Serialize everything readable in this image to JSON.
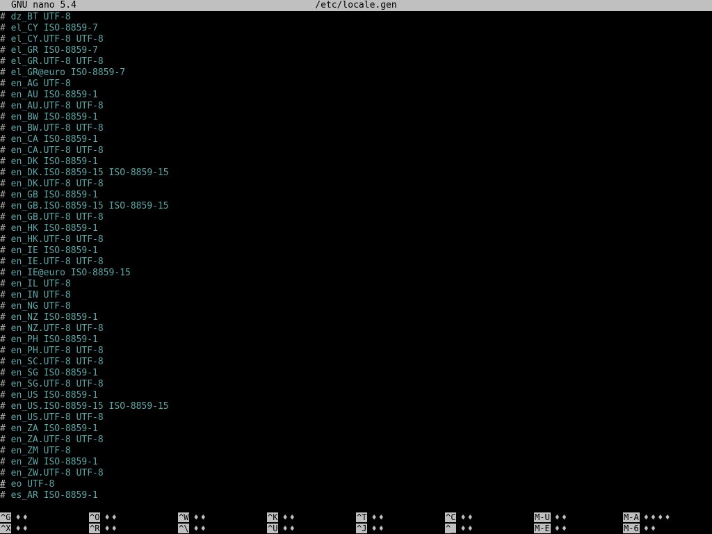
{
  "title_bar": {
    "app": "GNU nano 5.4",
    "file": "/etc/locale.gen"
  },
  "lines": [
    {
      "hash": "#",
      "text": " dz_BT UTF-8"
    },
    {
      "hash": "#",
      "text": " el_CY ISO-8859-7"
    },
    {
      "hash": "#",
      "text": " el_CY.UTF-8 UTF-8"
    },
    {
      "hash": "#",
      "text": " el_GR ISO-8859-7"
    },
    {
      "hash": "#",
      "text": " el_GR.UTF-8 UTF-8"
    },
    {
      "hash": "#",
      "text": " el_GR@euro ISO-8859-7"
    },
    {
      "hash": "#",
      "text": " en_AG UTF-8"
    },
    {
      "hash": "#",
      "text": " en_AU ISO-8859-1"
    },
    {
      "hash": "#",
      "text": " en_AU.UTF-8 UTF-8"
    },
    {
      "hash": "#",
      "text": " en_BW ISO-8859-1"
    },
    {
      "hash": "#",
      "text": " en_BW.UTF-8 UTF-8"
    },
    {
      "hash": "#",
      "text": " en_CA ISO-8859-1"
    },
    {
      "hash": "#",
      "text": " en_CA.UTF-8 UTF-8"
    },
    {
      "hash": "#",
      "text": " en_DK ISO-8859-1"
    },
    {
      "hash": "#",
      "text": " en_DK.ISO-8859-15 ISO-8859-15"
    },
    {
      "hash": "#",
      "text": " en_DK.UTF-8 UTF-8"
    },
    {
      "hash": "#",
      "text": " en_GB ISO-8859-1"
    },
    {
      "hash": "#",
      "text": " en_GB.ISO-8859-15 ISO-8859-15"
    },
    {
      "hash": "#",
      "text": " en_GB.UTF-8 UTF-8"
    },
    {
      "hash": "#",
      "text": " en_HK ISO-8859-1"
    },
    {
      "hash": "#",
      "text": " en_HK.UTF-8 UTF-8"
    },
    {
      "hash": "#",
      "text": " en_IE ISO-8859-1"
    },
    {
      "hash": "#",
      "text": " en_IE.UTF-8 UTF-8"
    },
    {
      "hash": "#",
      "text": " en_IE@euro ISO-8859-15"
    },
    {
      "hash": "#",
      "text": " en_IL UTF-8"
    },
    {
      "hash": "#",
      "text": " en_IN UTF-8"
    },
    {
      "hash": "#",
      "text": " en_NG UTF-8"
    },
    {
      "hash": "#",
      "text": " en_NZ ISO-8859-1"
    },
    {
      "hash": "#",
      "text": " en_NZ.UTF-8 UTF-8"
    },
    {
      "hash": "#",
      "text": " en_PH ISO-8859-1"
    },
    {
      "hash": "#",
      "text": " en_PH.UTF-8 UTF-8"
    },
    {
      "hash": "#",
      "text": " en_SC.UTF-8 UTF-8"
    },
    {
      "hash": "#",
      "text": " en_SG ISO-8859-1"
    },
    {
      "hash": "#",
      "text": " en_SG.UTF-8 UTF-8"
    },
    {
      "hash": "#",
      "text": " en_US ISO-8859-1"
    },
    {
      "hash": "#",
      "text": " en_US.ISO-8859-15 ISO-8859-15"
    },
    {
      "hash": "#",
      "text": " en_US.UTF-8 UTF-8"
    },
    {
      "hash": "#",
      "text": " en_ZA ISO-8859-1"
    },
    {
      "hash": "#",
      "text": " en_ZA.UTF-8 UTF-8"
    },
    {
      "hash": "#",
      "text": " en_ZM UTF-8"
    },
    {
      "hash": "#",
      "text": " en_ZW ISO-8859-1"
    },
    {
      "hash": "#",
      "text": " en_ZW.UTF-8 UTF-8"
    },
    {
      "hash": "#",
      "text": " eo UTF-8",
      "cursor": true
    },
    {
      "hash": "#",
      "text": " es_AR ISO-8859-1"
    }
  ],
  "shortcuts": {
    "row1": [
      {
        "key": "^G",
        "label": "♦♦"
      },
      {
        "key": "^O",
        "label": "♦♦"
      },
      {
        "key": "^W",
        "label": "♦♦"
      },
      {
        "key": "^K",
        "label": "♦♦"
      },
      {
        "key": "^T",
        "label": "♦♦"
      },
      {
        "key": "^C",
        "label": "♦♦"
      },
      {
        "key": "M-U",
        "label": "♦♦"
      },
      {
        "key": "M-A",
        "label": "♦♦♦♦"
      }
    ],
    "row2": [
      {
        "key": "^X",
        "label": "♦♦"
      },
      {
        "key": "^R",
        "label": "♦♦"
      },
      {
        "key": "^\\",
        "label": "♦♦"
      },
      {
        "key": "^U",
        "label": "♦♦"
      },
      {
        "key": "^J",
        "label": "♦♦"
      },
      {
        "key": "^_",
        "label": "♦♦"
      },
      {
        "key": "M-E",
        "label": "♦♦"
      },
      {
        "key": "M-6",
        "label": "♦♦"
      }
    ]
  },
  "colors": {
    "background": "#000000",
    "text": "#5ea8a8",
    "title_bar_bg": "#c0c0c0"
  }
}
